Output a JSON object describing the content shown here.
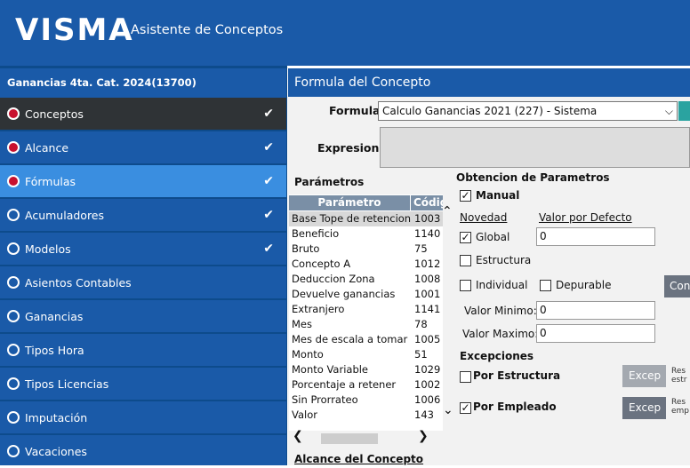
{
  "header": {
    "logo": "VISMA",
    "app_title": "Asistente de Conceptos"
  },
  "sidebar": {
    "project": "Ganancias 4ta. Cat. 2024(13700)",
    "items": [
      {
        "label": "Conceptos",
        "check": "✔"
      },
      {
        "label": "Alcance",
        "check": "✔"
      },
      {
        "label": "Fórmulas",
        "check": "✔"
      },
      {
        "label": "Acumuladores",
        "check": "✔"
      },
      {
        "label": "Modelos",
        "check": "✔"
      },
      {
        "label": "Asientos Contables"
      },
      {
        "label": "Ganancias"
      },
      {
        "label": "Tipos Hora"
      },
      {
        "label": "Tipos Licencias"
      },
      {
        "label": "Imputación"
      },
      {
        "label": "Vacaciones"
      }
    ]
  },
  "main": {
    "title": "Formula del Concepto",
    "formula_label": "Formula:",
    "formula_value": "Calculo Ganancias 2021 (227) - Sistema",
    "expresion_label": "Expresion:",
    "parametros_title": "Parámetros",
    "table": {
      "headers": [
        "Parámetro",
        "Códig"
      ],
      "rows": [
        [
          "Base Tope de retencion",
          "1003"
        ],
        [
          "Beneficio",
          "1140"
        ],
        [
          "Bruto",
          "75"
        ],
        [
          "Concepto A",
          "1012"
        ],
        [
          "Deduccion Zona",
          "1008"
        ],
        [
          "Devuelve ganancias",
          "1001"
        ],
        [
          "Extranjero",
          "1141"
        ],
        [
          "Mes",
          "78"
        ],
        [
          "Mes de escala a tomar",
          "1005"
        ],
        [
          "Monto",
          "51"
        ],
        [
          "Monto Variable",
          "1029"
        ],
        [
          "Porcentaje a retener",
          "1002"
        ],
        [
          "Sin Prorrateo",
          "1006"
        ],
        [
          "Valor",
          "143"
        ]
      ]
    },
    "alcance_link": "Alcance del Concepto",
    "obtencion": {
      "title": "Obtencion de Parametros",
      "manual": "Manual",
      "novedad": "Novedad",
      "valor_defecto": "Valor por Defecto",
      "global": "Global",
      "global_value": "0",
      "estructura": "Estructura",
      "individual": "Individual",
      "depurable": "Depurable",
      "con_btn": "Con",
      "valor_minimo_label": "Valor Minimo:",
      "valor_minimo": "0",
      "valor_maximo_label": "Valor Maximo:",
      "valor_maximo": "0",
      "excepciones": "Excepciones",
      "por_estructura": "Por Estructura",
      "por_empleado": "Por Empleado",
      "excep_btn": "Excep",
      "res1_a": "Res",
      "res1_b": "estr",
      "res2_a": "Res",
      "res2_b": "emp"
    }
  }
}
